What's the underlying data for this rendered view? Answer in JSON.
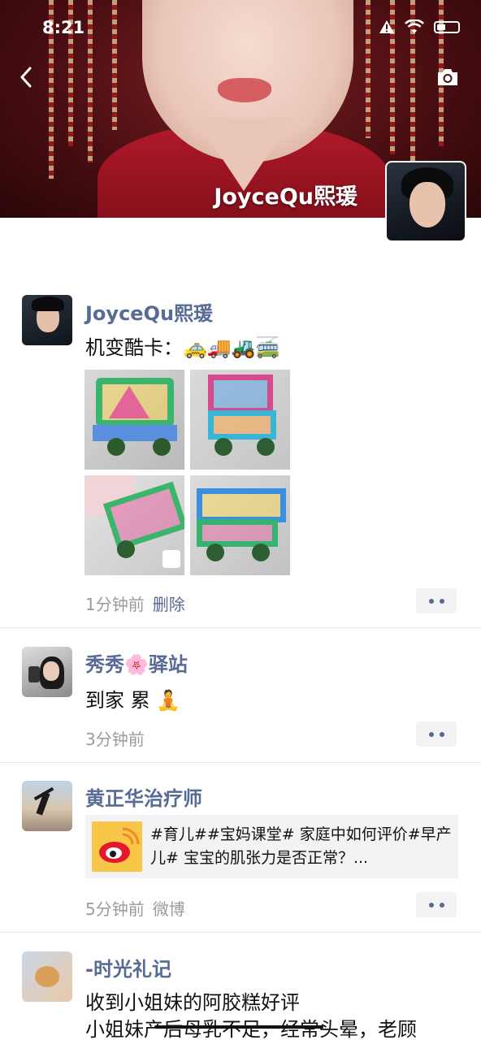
{
  "status_bar": {
    "time": "8:21"
  },
  "profile": {
    "name": "JoyceQu熙瑗"
  },
  "posts": [
    {
      "author": "JoyceQu熙瑗",
      "text": "机变酷卡：🚕🚚🚜🚎",
      "time": "1分钟前",
      "delete_label": "删除"
    },
    {
      "author": "秀秀🌸驿站",
      "text": "到家 累 🧘",
      "time": "3分钟前"
    },
    {
      "author": "黄正华治疗师",
      "share_text": "#育儿##宝妈课堂# 家庭中如何评价#早产儿# 宝宝的肌张力是否正常？...",
      "time": "5分钟前",
      "source": "微博"
    },
    {
      "author": "-时光礼记",
      "line1": "收到小姐妹的阿胶糕好评",
      "line2": "小姐妹产后母乳不足，经常头晕，老顾"
    }
  ]
}
